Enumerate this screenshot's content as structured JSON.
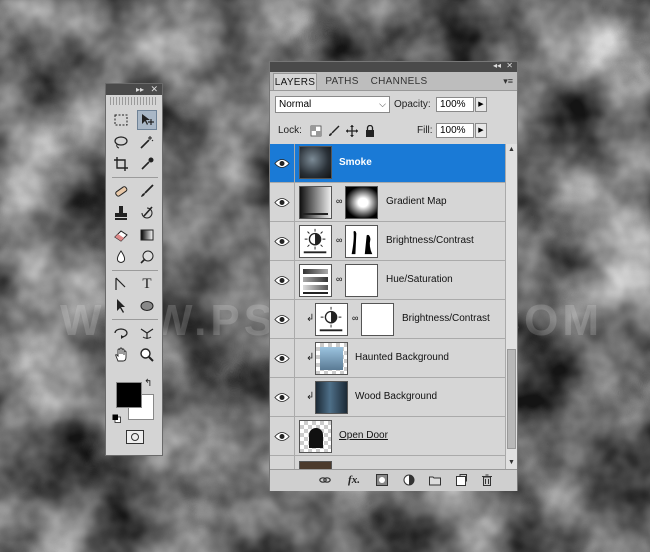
{
  "canvas": {
    "watermark": "WWW.PSD-DUDE.COM"
  },
  "tools_panel": {
    "collapse_glyph": "▸▸",
    "close_glyph": "✕",
    "tools": [
      "rectangular-marquee-icon",
      "move-icon",
      "lasso-icon",
      "magic-wand-icon",
      "crop-icon",
      "eyedropper-icon",
      "healing-brush-icon",
      "brush-icon",
      "clone-stamp-icon",
      "history-brush-icon",
      "eraser-icon",
      "gradient-icon",
      "blur-icon",
      "dodge-icon",
      "pen-icon",
      "type-icon",
      "path-selection-icon",
      "ellipse-icon",
      "3d-rotate-icon",
      "3d-orbit-icon",
      "hand-icon",
      "zoom-icon"
    ],
    "type_glyph": "T",
    "foreground_color": "#000000",
    "background_color": "#ffffff"
  },
  "layers_panel": {
    "collapse_glyph": "◂◂",
    "close_glyph": "✕",
    "tabs": [
      {
        "label": "LAYERS",
        "active": true
      },
      {
        "label": "PATHS",
        "active": false
      },
      {
        "label": "CHANNELS",
        "active": false
      }
    ],
    "menu_glyph": "▾≡",
    "blend_mode": "Normal",
    "opacity_label": "Opacity:",
    "opacity_value": "100%",
    "lock_label": "Lock:",
    "fill_label": "Fill:",
    "fill_value": "100%",
    "layers": [
      {
        "name": "Smoke",
        "selected": true,
        "thumb": "smoke",
        "clipped": false
      },
      {
        "name": "Gradient Map",
        "selected": false,
        "thumb": "gradient-map",
        "clipped": false
      },
      {
        "name": "Brightness/Contrast",
        "selected": false,
        "thumb": "brightness",
        "clipped": false
      },
      {
        "name": "Hue/Saturation",
        "selected": false,
        "thumb": "hue-saturation",
        "clipped": false
      },
      {
        "name": "Brightness/Contrast",
        "selected": false,
        "thumb": "brightness",
        "clipped": true
      },
      {
        "name": "Haunted Background",
        "selected": false,
        "thumb": "haunted",
        "clipped": true
      },
      {
        "name": "Wood Background",
        "selected": false,
        "thumb": "wood",
        "clipped": true
      },
      {
        "name": "Open Door",
        "selected": false,
        "thumb": "door",
        "clipped": false
      }
    ],
    "footer_buttons": [
      "link-layers-icon",
      "fx-icon",
      "add-mask-icon",
      "adjustment-layer-icon",
      "new-group-icon",
      "new-layer-icon",
      "delete-layer-icon"
    ],
    "fx_label": "fx."
  }
}
